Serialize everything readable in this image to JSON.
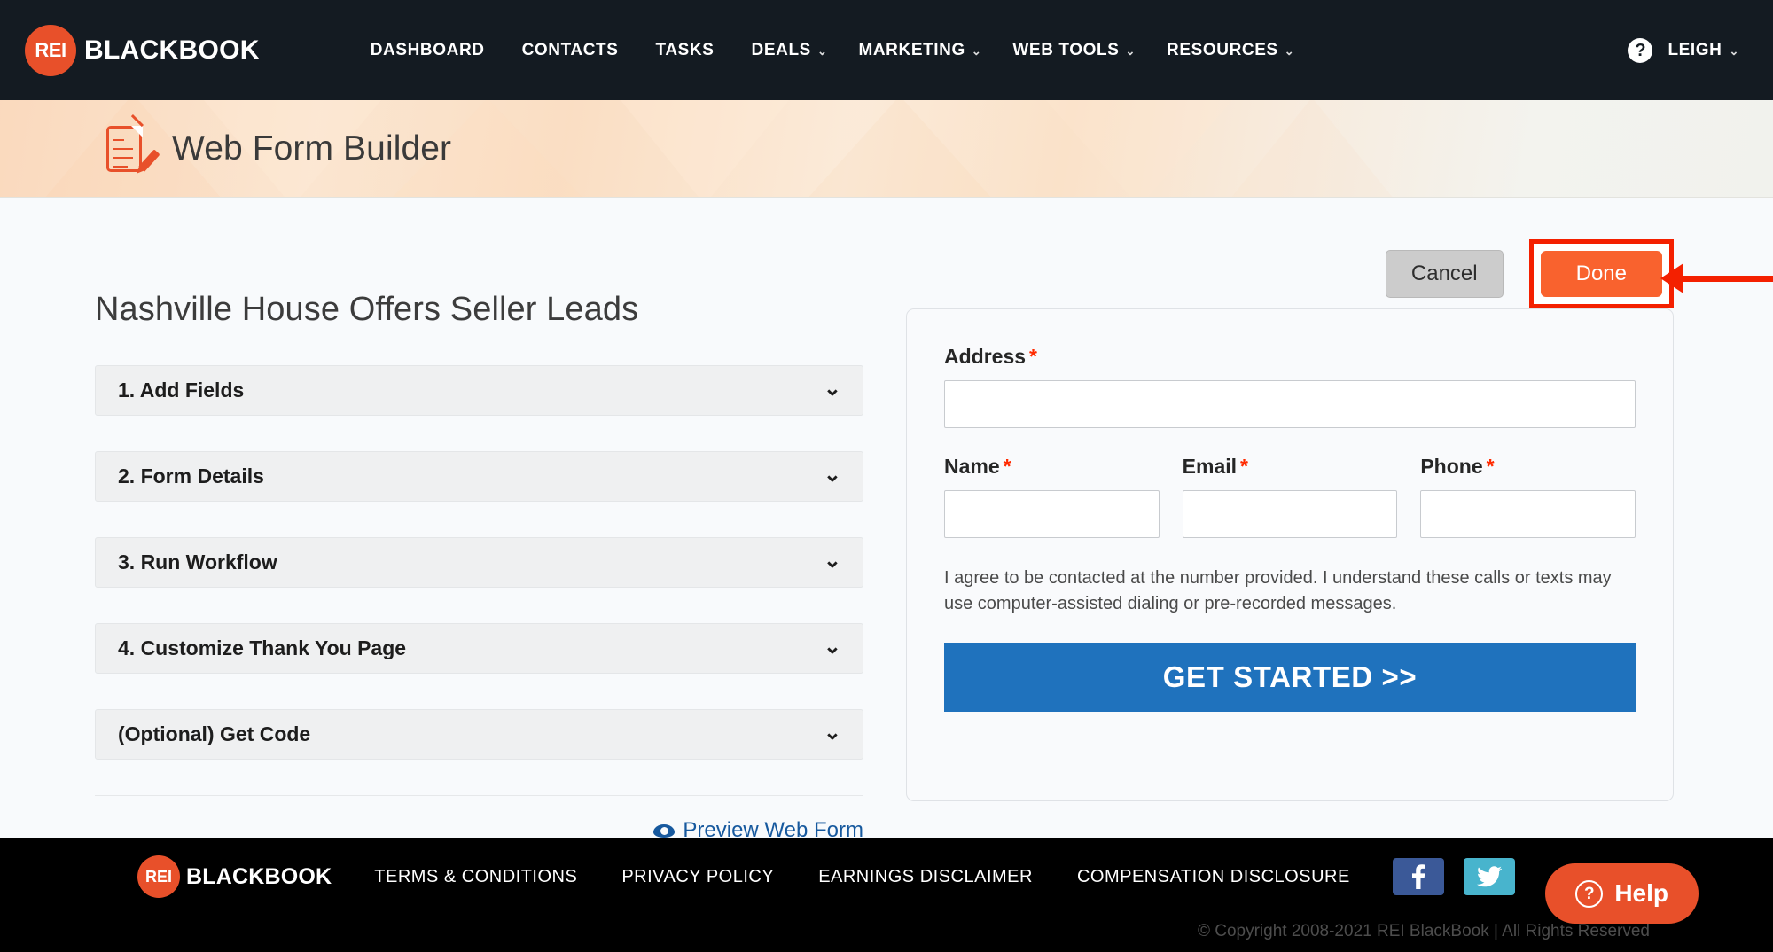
{
  "topnav": {
    "brand_badge": "REI",
    "brand_word": "BLACKBOOK",
    "items": [
      {
        "label": "DASHBOARD",
        "caret": ""
      },
      {
        "label": "CONTACTS",
        "caret": ""
      },
      {
        "label": "TASKS",
        "caret": ""
      },
      {
        "label": "DEALS",
        "caret": "⌄"
      },
      {
        "label": "MARKETING",
        "caret": "⌄"
      },
      {
        "label": "WEB TOOLS",
        "caret": "⌄"
      },
      {
        "label": "RESOURCES",
        "caret": "⌄"
      }
    ],
    "help_glyph": "?",
    "user": "LEIGH",
    "user_caret": "⌄"
  },
  "subheader": {
    "title": "Web Form Builder",
    "icon": "web-form-builder-icon"
  },
  "actions": {
    "cancel_label": "Cancel",
    "done_label": "Done",
    "highlight_color": "#f42000",
    "done_color": "#f9622e",
    "cancel_color": "#cccccc"
  },
  "builder": {
    "form_name": "Nashville House Offers Seller Leads",
    "sections": [
      {
        "label": "1. Add Fields",
        "chevron": "⌄"
      },
      {
        "label": "2. Form Details",
        "chevron": "⌄"
      },
      {
        "label": "3. Run Workflow",
        "chevron": "⌄"
      },
      {
        "label": "4. Customize Thank You Page",
        "chevron": "⌄"
      },
      {
        "label": "(Optional) Get Code",
        "chevron": "⌄"
      }
    ],
    "preview_link": "Preview Web Form"
  },
  "preview": {
    "address_label": "Address",
    "name_label": "Name",
    "email_label": "Email",
    "phone_label": "Phone",
    "required_mark": "*",
    "address_value": "",
    "name_value": "",
    "email_value": "",
    "phone_value": "",
    "consent_text": "I agree to be contacted at the number provided. I understand these calls or texts may use computer-assisted dialing or pre-recorded messages.",
    "cta_label": "GET STARTED >>",
    "cta_color": "#1f72bd"
  },
  "footer": {
    "brand_badge": "REI",
    "brand_word": "BLACKBOOK",
    "links": [
      "TERMS & CONDITIONS",
      "PRIVACY POLICY",
      "EARNINGS DISCLAIMER",
      "COMPENSATION DISCLOSURE"
    ],
    "facebook_color": "#3b5998",
    "twitter_color": "#48b4cd",
    "copyright": "© Copyright 2008-2021 REI BlackBook | All Rights Reserved",
    "help_label": "Help",
    "help_glyph": "?"
  }
}
